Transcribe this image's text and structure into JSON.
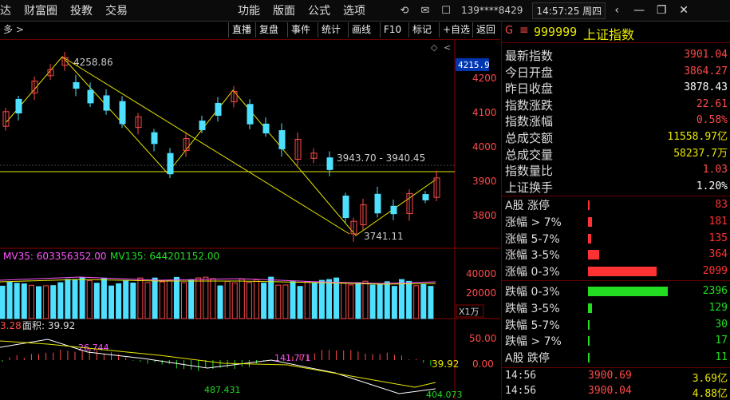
{
  "menubar": {
    "left": [
      "达",
      "财富圈",
      "投教",
      "交易"
    ],
    "mid": [
      "功能",
      "版面",
      "公式",
      "选项"
    ],
    "account": "139****8429",
    "clock": "14:57:25 周四"
  },
  "toolbar": {
    "left_tab": "多 >",
    "buttons": [
      "直播",
      "复盘",
      "事件",
      "统计",
      "画线",
      "F10",
      "标记",
      "+自选",
      "返回"
    ]
  },
  "security": {
    "flag": "G",
    "code": "999999",
    "name": "上证指数"
  },
  "stats": [
    {
      "label": "最新指数",
      "value": "3901.04",
      "color": "#ff4a4a"
    },
    {
      "label": "今日开盘",
      "value": "3864.27",
      "color": "#ff4a4a"
    },
    {
      "label": "昨日收盘",
      "value": "3878.43",
      "color": "#ffffff"
    },
    {
      "label": "指数涨跌",
      "value": "22.61",
      "color": "#ff4a4a"
    },
    {
      "label": "指数涨幅",
      "value": "0.58%",
      "color": "#ff4a4a"
    },
    {
      "label": "总成交额",
      "value": "11558.97亿",
      "color": "#e8e800"
    },
    {
      "label": "总成交量",
      "value": "58237.7万",
      "color": "#e8e800"
    },
    {
      "label": "指数量比",
      "value": "1.03",
      "color": "#ff4a4a"
    },
    {
      "label": "上证换手",
      "value": "1.20%",
      "color": "#ffffff"
    }
  ],
  "distribution": [
    {
      "label": "A股 涨停",
      "value": "83",
      "color": "#ff3333",
      "bar": 0.02
    },
    {
      "label": "涨幅 > 7%",
      "value": "181",
      "color": "#ff3333",
      "bar": 0.05
    },
    {
      "label": "涨幅 5-7%",
      "value": "135",
      "color": "#ff3333",
      "bar": 0.04
    },
    {
      "label": "涨幅 3-5%",
      "value": "364",
      "color": "#ff3333",
      "bar": 0.14
    },
    {
      "label": "涨幅 0-3%",
      "value": "2099",
      "color": "#ff3333",
      "bar": 0.86
    },
    {
      "label": "跌幅 0-3%",
      "value": "2396",
      "color": "#22dd22",
      "bar": 1.0
    },
    {
      "label": "跌幅 3-5%",
      "value": "129",
      "color": "#22dd22",
      "bar": 0.05
    },
    {
      "label": "跌幅 5-7%",
      "value": "30",
      "color": "#22dd22",
      "bar": 0.01
    },
    {
      "label": "跌幅 > 7%",
      "value": "17",
      "color": "#22dd22",
      "bar": 0.01
    },
    {
      "label": "A股 跌停",
      "value": "11",
      "color": "#22dd22",
      "bar": 0.01
    }
  ],
  "ticks": [
    {
      "time": "14:56",
      "price": "3900.69",
      "vol": "3.69亿"
    },
    {
      "time": "14:56",
      "price": "3900.04",
      "vol": "4.88亿"
    }
  ],
  "chart": {
    "price_axis": [
      "4200",
      "4100",
      "4000",
      "3900",
      "3800"
    ],
    "price_tag": "4215.9",
    "annotations": {
      "high": "4258.86",
      "mid": "3943.70 - 3940.45",
      "low": "3741.11"
    },
    "volume_legend": {
      "ma1": "MV35: 603356352.00",
      "ma2": "MV135: 644201152.00"
    },
    "volume_axis": [
      "40000",
      "20000"
    ],
    "volume_unit": "X1万",
    "indicator_legend": {
      "prefix": "3.28",
      "label": "面积: 39.92"
    },
    "indicator_axis": [
      "50.00",
      "0.00"
    ],
    "indicator_current": "39.92",
    "indicator_marks": [
      "26.744",
      "141.771",
      "487.431",
      "404.073"
    ]
  }
}
